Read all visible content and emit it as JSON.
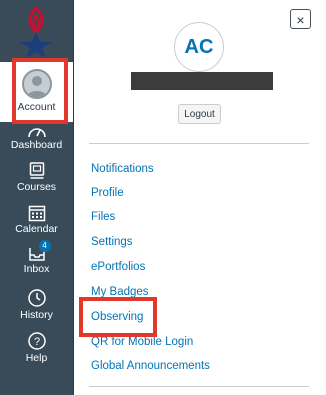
{
  "nav": {
    "account_label": "Account",
    "items": [
      {
        "label": "Dashboard",
        "icon": "dashboard-icon"
      },
      {
        "label": "Courses",
        "icon": "courses-icon"
      },
      {
        "label": "Calendar",
        "icon": "calendar-icon"
      },
      {
        "label": "Inbox",
        "icon": "inbox-icon",
        "badge": "4"
      },
      {
        "label": "History",
        "icon": "history-icon"
      },
      {
        "label": "Help",
        "icon": "help-icon"
      }
    ]
  },
  "tray": {
    "close_label": "×",
    "avatar_initials": "AC",
    "logout_label": "Logout",
    "links": [
      "Notifications",
      "Profile",
      "Files",
      "Settings",
      "ePortfolios",
      "My Badges",
      "Observing",
      "QR for Mobile Login",
      "Global Announcements"
    ]
  },
  "colors": {
    "nav_bg": "#394b58",
    "link": "#0374b5",
    "highlight": "#e2382c",
    "badge": "#0374b5"
  }
}
